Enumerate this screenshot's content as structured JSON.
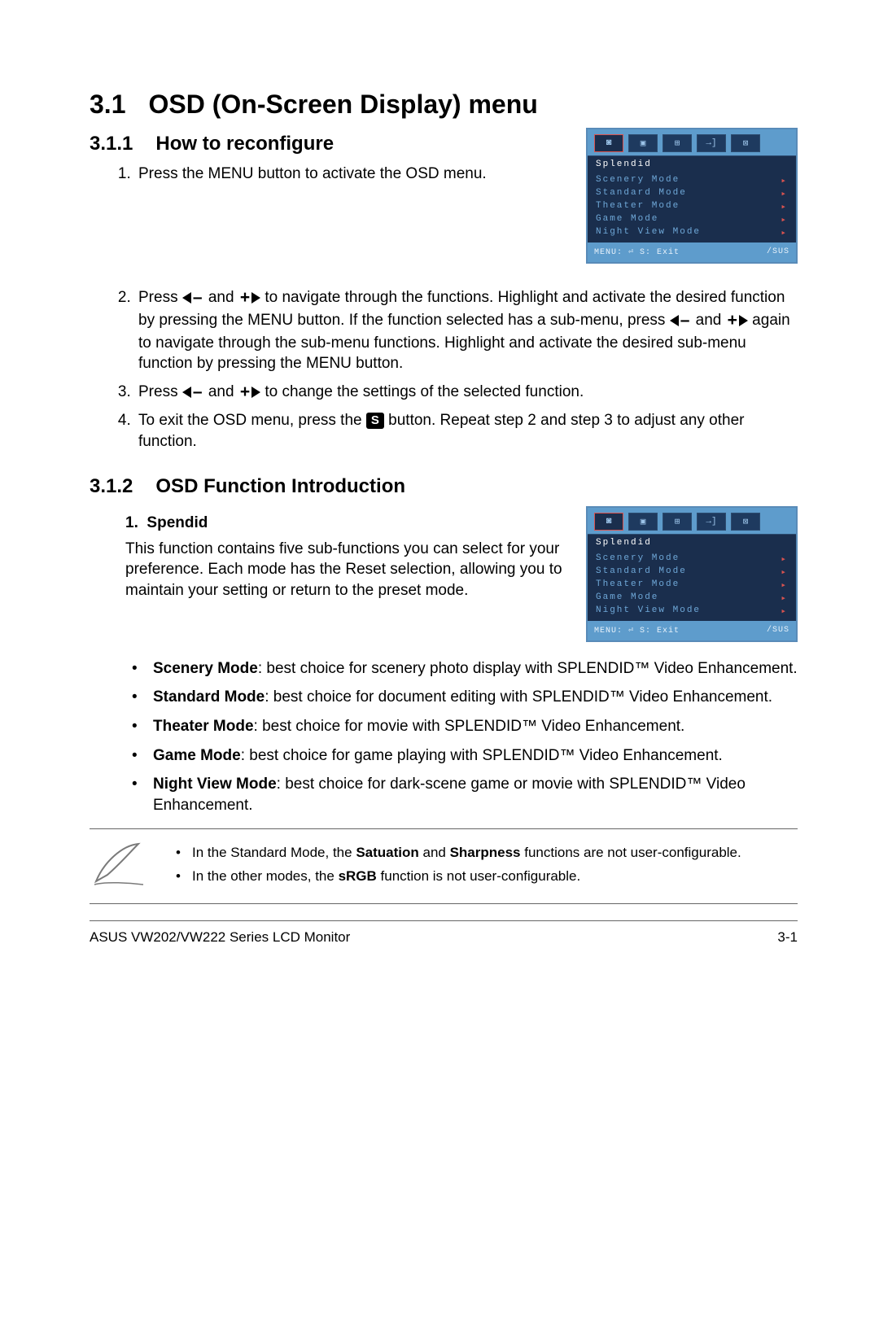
{
  "heading": {
    "num": "3.1",
    "title": "OSD (On-Screen Display) menu"
  },
  "sub1": {
    "num": "3.1.1",
    "title": "How to reconfigure"
  },
  "steps": {
    "s1": "Press the MENU button to activate the OSD menu.",
    "s2a": "Press ",
    "s2b": " and ",
    "s2c": " to navigate through the functions. Highlight and activate the desired function by pressing the MENU button. If the function selected has a sub-menu, press ",
    "s2d": " and ",
    "s2e": " again to navigate through the sub-menu functions. Highlight and activate the desired sub-menu function by pressing the MENU button.",
    "s3a": "Press ",
    "s3b": " and ",
    "s3c": " to change the settings of the selected function.",
    "s4a": "To exit the OSD menu, press the ",
    "s4b": " button. Repeat step 2 and step 3 to adjust any other function."
  },
  "sub2": {
    "num": "3.1.2",
    "title": "OSD Function Introduction"
  },
  "splendid": {
    "num_label": "1.",
    "heading": "Spendid",
    "para_a": "This function contains five sub-functions you can select for your preference. Each mode has the Reset selection, allowing you to maintain your setting or return to the preset mode."
  },
  "modes": [
    {
      "name": "Scenery Mode",
      "desc": ": best choice for scenery photo display with SPLENDID™ Video Enhancement."
    },
    {
      "name": "Standard Mode",
      "desc": ": best choice for document editing with SPLENDID™ Video Enhancement."
    },
    {
      "name": "Theater Mode",
      "desc": ": best choice for movie with SPLENDID™ Video Enhancement."
    },
    {
      "name": "Game Mode",
      "desc": ": best choice for game playing with SPLENDID™ Video Enhancement."
    },
    {
      "name": "Night View Mode",
      "desc": ": best choice for dark-scene game or movie with SPLENDID™ Video Enhancement."
    }
  ],
  "notes": {
    "n1a": "In the Standard Mode, the ",
    "n1b": "Satuation",
    "n1c": " and ",
    "n1d": "Sharpness",
    "n1e": " functions are not user-configurable.",
    "n2a": "In the other modes, the ",
    "n2b": "sRGB",
    "n2c": " function is not user-configurable."
  },
  "osd": {
    "title": "Splendid",
    "items": [
      "Scenery Mode",
      "Standard Mode",
      "Theater Mode",
      "Game Mode",
      "Night View Mode"
    ],
    "footer_left": "MENU: ⏎  S: Exit",
    "footer_right": "/SUS"
  },
  "footer": {
    "left": "ASUS VW202/VW222 Series LCD Monitor",
    "right": "3-1"
  },
  "icons": {
    "minus": "–",
    "plus": "+",
    "s": "S"
  }
}
